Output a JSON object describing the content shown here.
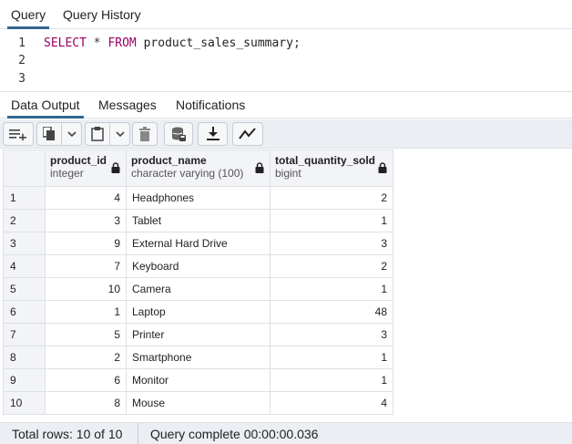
{
  "query_tabs": {
    "query": "Query",
    "history": "Query History"
  },
  "editor": {
    "line_numbers": [
      "1",
      "2",
      "3"
    ],
    "sql": {
      "select": "SELECT",
      "star": "*",
      "from": "FROM",
      "table": "product_sales_summary",
      "semicolon": ";"
    }
  },
  "result_tabs": {
    "data_output": "Data Output",
    "messages": "Messages",
    "notifications": "Notifications"
  },
  "toolbar": {
    "icons": [
      "add-row-icon",
      "copy-icon",
      "dropdown-icon",
      "paste-icon",
      "dropdown-icon",
      "delete-icon",
      "save-data-icon",
      "download-icon",
      "graph-icon"
    ]
  },
  "columns": [
    {
      "name": "product_id",
      "type": "integer"
    },
    {
      "name": "product_name",
      "type": "character varying (100)"
    },
    {
      "name": "total_quantity_sold",
      "type": "bigint"
    }
  ],
  "rows": [
    {
      "n": "1",
      "product_id": "4",
      "product_name": "Headphones",
      "total_quantity_sold": "2"
    },
    {
      "n": "2",
      "product_id": "3",
      "product_name": "Tablet",
      "total_quantity_sold": "1"
    },
    {
      "n": "3",
      "product_id": "9",
      "product_name": "External Hard Drive",
      "total_quantity_sold": "3"
    },
    {
      "n": "4",
      "product_id": "7",
      "product_name": "Keyboard",
      "total_quantity_sold": "2"
    },
    {
      "n": "5",
      "product_id": "10",
      "product_name": "Camera",
      "total_quantity_sold": "1"
    },
    {
      "n": "6",
      "product_id": "1",
      "product_name": "Laptop",
      "total_quantity_sold": "48"
    },
    {
      "n": "7",
      "product_id": "5",
      "product_name": "Printer",
      "total_quantity_sold": "3"
    },
    {
      "n": "8",
      "product_id": "2",
      "product_name": "Smartphone",
      "total_quantity_sold": "1"
    },
    {
      "n": "9",
      "product_id": "6",
      "product_name": "Monitor",
      "total_quantity_sold": "1"
    },
    {
      "n": "10",
      "product_id": "8",
      "product_name": "Mouse",
      "total_quantity_sold": "4"
    }
  ],
  "status": {
    "total_rows": "Total rows: 10 of 10",
    "query_complete": "Query complete 00:00:00.036"
  },
  "colors": {
    "active_tab": "#326690",
    "keyword": "#990066",
    "toolbar_bg": "#ebeef3"
  }
}
